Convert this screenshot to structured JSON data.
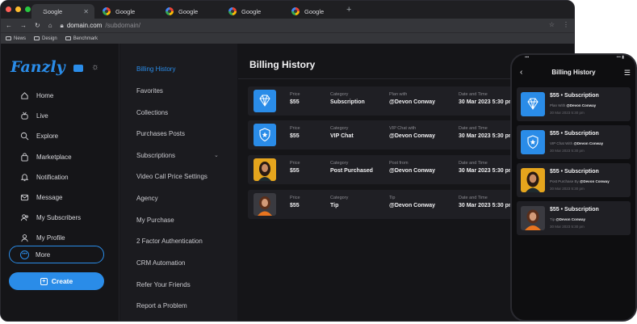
{
  "browser": {
    "tabs": [
      {
        "label": "Google",
        "active": true
      },
      {
        "label": "Google",
        "active": false
      },
      {
        "label": "Google",
        "active": false
      },
      {
        "label": "Google",
        "active": false
      },
      {
        "label": "Google",
        "active": false
      }
    ],
    "url_host": "domain.com",
    "url_path": "/subdomain/",
    "bookmarks": [
      "News",
      "Design",
      "Benchmark"
    ]
  },
  "sidebar": {
    "logo": "Fanzly",
    "items": [
      {
        "label": "Home",
        "icon": "home-icon"
      },
      {
        "label": "Live",
        "icon": "live-tv-icon"
      },
      {
        "label": "Explore",
        "icon": "search-icon"
      },
      {
        "label": "Marketplace",
        "icon": "shopping-bag-icon"
      },
      {
        "label": "Notification",
        "icon": "bell-icon"
      },
      {
        "label": "Message",
        "icon": "message-icon"
      },
      {
        "label": "My Subscribers",
        "icon": "users-icon"
      },
      {
        "label": "My Profile",
        "icon": "user-icon"
      }
    ],
    "more_label": "More",
    "create_label": "Create"
  },
  "settings_menu": {
    "items": [
      {
        "label": "Billing History",
        "active": true
      },
      {
        "label": "Favorites",
        "active": false
      },
      {
        "label": "Collections",
        "active": false
      },
      {
        "label": "Purchases Posts",
        "active": false
      },
      {
        "label": "Subscriptions",
        "active": false,
        "expandable": true
      },
      {
        "label": "Video Call Price Settings",
        "active": false
      },
      {
        "label": "Agency",
        "active": false
      },
      {
        "label": "My Purchase",
        "active": false
      },
      {
        "label": "2 Factor Authentication",
        "active": false
      },
      {
        "label": "CRM Automation",
        "active": false
      },
      {
        "label": "Refer Your Friends",
        "active": false
      },
      {
        "label": "Report a Problem",
        "active": false
      }
    ]
  },
  "billing": {
    "title": "Billing History",
    "rows": [
      {
        "thumb": "diamond-icon",
        "price_label": "Price",
        "price": "$55",
        "category_label": "Category",
        "category": "Subscription",
        "who_label": "Plan with",
        "who": "@Devon Conway",
        "date_label": "Date and Time",
        "date": "30 Mar 2023 5:30 pm"
      },
      {
        "thumb": "shield-star-icon",
        "price_label": "Price",
        "price": "$55",
        "category_label": "Category",
        "category": "VIP Chat",
        "who_label": "VIP Chat with",
        "who": "@Devon Conway",
        "date_label": "Date and Time",
        "date": "30 Mar 2023 5:30 pm"
      },
      {
        "thumb": "avatar-photo",
        "price_label": "Price",
        "price": "$55",
        "category_label": "Category",
        "category": "Post Purchased",
        "who_label": "Post from",
        "who": "@Devon Conway",
        "date_label": "Date and Time",
        "date": "30 Mar 2023 5:30 pm"
      },
      {
        "thumb": "avatar-photo",
        "price_label": "Price",
        "price": "$55",
        "category_label": "Category",
        "category": "Tip",
        "who_label": "Tip",
        "who": "@Devon Conway",
        "date_label": "Date and Time",
        "date": "30 Mar 2023 5:30 pm"
      }
    ]
  },
  "phone": {
    "title": "Billing History",
    "cards": [
      {
        "title": "$55  •  Subscription",
        "sub_label": "Plan With",
        "sub_user": "@Devon Conway",
        "date": "30 Mar 2023 5:30 pm"
      },
      {
        "title": "$55  •  Subscription",
        "sub_label": "VIP Chat With",
        "sub_user": "@Devon Conway",
        "date": "30 Mar 2023 5:30 pm"
      },
      {
        "title": "$55  •  Subscription",
        "sub_label": "Post Purchase By",
        "sub_user": "@Devon Conway",
        "date": "30 Mar 2023 5:30 pm"
      },
      {
        "title": "$55  •  Subscription",
        "sub_label": "Tip",
        "sub_user": "@Devon Conway",
        "date": "30 Mar 2023 5:30 pm"
      }
    ]
  },
  "colors": {
    "accent": "#2a8ce8",
    "background": "#151518",
    "card": "#1f1f24"
  }
}
